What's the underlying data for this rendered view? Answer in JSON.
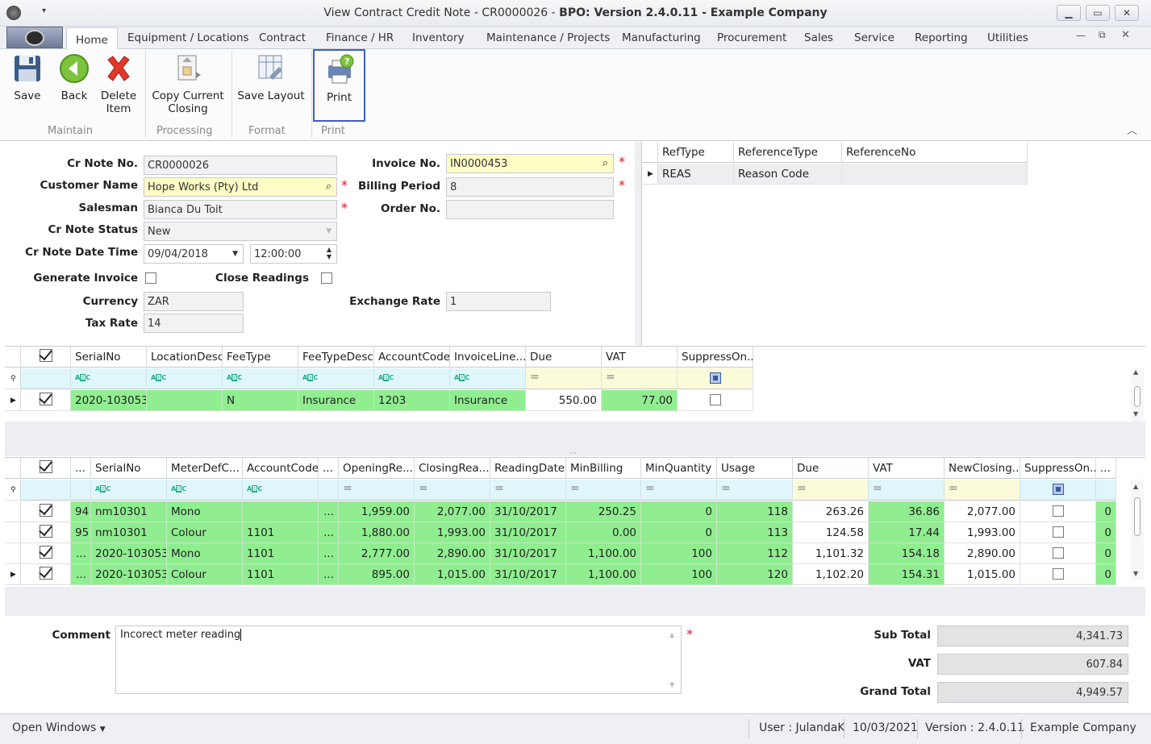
{
  "window": {
    "title_prefix": "View Contract Credit Note  - CR0000026 - ",
    "title_bold": "BPO: Version 2.4.0.11 - Example Company",
    "logo": "BPO"
  },
  "tabs": [
    "Home",
    "Equipment / Locations",
    "Contract",
    "Finance / HR",
    "Inventory",
    "Maintenance / Projects",
    "Manufacturing",
    "Procurement",
    "Sales",
    "Service",
    "Reporting",
    "Utilities"
  ],
  "ribbon": {
    "save": "Save",
    "back": "Back",
    "delete_1": "Delete",
    "delete_2": "Item",
    "copy_1": "Copy Current",
    "copy_2": "Closing",
    "save_layout": "Save Layout",
    "print": "Print",
    "groups": {
      "maintain": "Maintain",
      "processing": "Processing",
      "format": "Format",
      "print": "Print"
    }
  },
  "form": {
    "cr_note_no_label": "Cr Note No.",
    "cr_note_no": "CR0000026",
    "customer_name_label": "Customer Name",
    "customer_name": "Hope Works (Pty) Ltd",
    "salesman_label": "Salesman",
    "salesman": "Bianca Du Toit",
    "status_label": "Cr Note Status",
    "status": "New",
    "date_label": "Cr Note Date Time",
    "date": "09/04/2018",
    "time": "12:00:00",
    "generate_invoice_label": "Generate Invoice",
    "close_readings_label": "Close Readings",
    "currency_label": "Currency",
    "currency": "ZAR",
    "tax_rate_label": "Tax Rate",
    "tax_rate": "14",
    "invoice_no_label": "Invoice No.",
    "invoice_no": "IN0000453",
    "billing_period_label": "Billing Period",
    "billing_period": "8",
    "order_no_label": "Order No.",
    "order_no": "",
    "exchange_rate_label": "Exchange Rate",
    "exchange_rate": "1"
  },
  "ref_grid": {
    "headers": [
      "RefType",
      "ReferenceType",
      "ReferenceNo"
    ],
    "rows": [
      [
        "REAS",
        "Reason Code",
        ""
      ]
    ]
  },
  "fee_grid": {
    "headers": [
      "SerialNo",
      "LocationDesc",
      "FeeType",
      "FeeTypeDesc",
      "AccountCode",
      "InvoiceLine...",
      "Due",
      "VAT",
      "SuppressOn..."
    ],
    "rows": [
      [
        "2020-103053",
        "",
        "N",
        "Insurance",
        "1203",
        "Insurance",
        "550.00",
        "77.00",
        ""
      ]
    ]
  },
  "meter_grid": {
    "headers": [
      "...",
      "SerialNo",
      "MeterDefC...",
      "AccountCode",
      "...",
      "OpeningRe...",
      "ClosingRea...",
      "ReadingDate",
      "MinBilling",
      "MinQuantity",
      "Usage",
      "Due",
      "VAT",
      "NewClosing...",
      "SuppressOn...",
      "..."
    ],
    "rows": [
      [
        "94",
        "nm10301",
        "Mono",
        "",
        "...",
        "1,959.00",
        "2,077.00",
        "31/10/2017",
        "250.25",
        "0",
        "118",
        "263.26",
        "36.86",
        "2,077.00",
        "",
        "0"
      ],
      [
        "95",
        "nm10301",
        "Colour",
        "1101",
        "...",
        "1,880.00",
        "1,993.00",
        "31/10/2017",
        "0.00",
        "0",
        "113",
        "124.58",
        "17.44",
        "1,993.00",
        "",
        "0"
      ],
      [
        "...",
        "2020-103053",
        "Mono",
        "1101",
        "...",
        "2,777.00",
        "2,890.00",
        "31/10/2017",
        "1,100.00",
        "100",
        "112",
        "1,101.32",
        "154.18",
        "2,890.00",
        "",
        "0"
      ],
      [
        "...",
        "2020-103053",
        "Colour",
        "1101",
        "...",
        "895.00",
        "1,015.00",
        "31/10/2017",
        "1,100.00",
        "100",
        "120",
        "1,102.20",
        "154.31",
        "1,015.00",
        "",
        "0"
      ]
    ]
  },
  "footer": {
    "comment_label": "Comment",
    "comment": "Incorect meter reading",
    "sub_total_label": "Sub Total",
    "sub_total": "4,341.73",
    "vat_label": "VAT",
    "vat": "607.84",
    "grand_total_label": "Grand Total",
    "grand_total": "4,949.57"
  },
  "statusbar": {
    "open_windows": "Open Windows",
    "user": "User : JulandaK",
    "date": "10/03/2021",
    "version": "Version : 2.4.0.11",
    "company": "Example Company"
  },
  "colors": {
    "green_row": "#90ee90",
    "required": "#dd1122",
    "filter_row": "#dff6fb",
    "yellow_field": "#fdfdc5",
    "focus_border": "#3b5fc0"
  }
}
